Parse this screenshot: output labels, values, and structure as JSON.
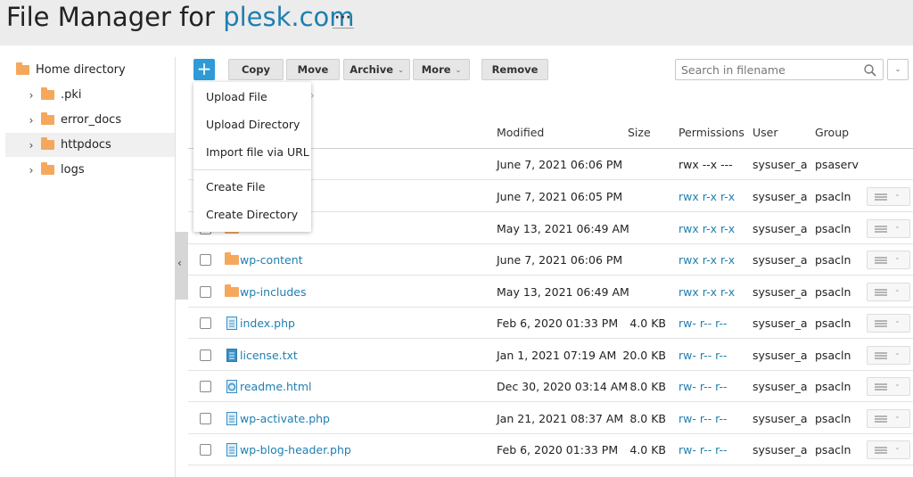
{
  "header": {
    "title_prefix": "File Manager for",
    "domain": "plesk.com",
    "menu_label": "···"
  },
  "sidebar": {
    "items": [
      {
        "label": "Home directory"
      },
      {
        "label": ".pki"
      },
      {
        "label": "error_docs"
      },
      {
        "label": "httpdocs"
      },
      {
        "label": "logs"
      }
    ],
    "collapse_icon": "chevron-left-icon"
  },
  "toolbar": {
    "add_label": "+",
    "copy": "Copy",
    "move": "Move",
    "archive": "Archive",
    "more": "More",
    "remove": "Remove"
  },
  "search": {
    "placeholder": "Search in filename"
  },
  "dropdown": {
    "items": [
      "Upload File",
      "Upload Directory",
      "Import file via URL",
      "Create File",
      "Create Directory"
    ]
  },
  "table": {
    "columns": {
      "modified": "Modified",
      "size": "Size",
      "permissions": "Permissions",
      "user": "User",
      "group": "Group"
    },
    "rows": [
      {
        "name": "",
        "modified": "June 7, 2021 06:06 PM",
        "size": "",
        "perm": "rwx --x ---",
        "user": "sysuser_a",
        "group": "psaserv"
      },
      {
        "name": "",
        "modified": "June 7, 2021 06:05 PM",
        "size": "",
        "perm": "rwx r-x r-x",
        "user": "sysuser_a",
        "group": "psacln"
      },
      {
        "name": "",
        "modified": "May 13, 2021 06:49 AM",
        "size": "",
        "perm": "rwx r-x r-x",
        "user": "sysuser_a",
        "group": "psacln"
      },
      {
        "name": "wp-content",
        "modified": "June 7, 2021 06:06 PM",
        "size": "",
        "perm": "rwx r-x r-x",
        "user": "sysuser_a",
        "group": "psacln"
      },
      {
        "name": "wp-includes",
        "modified": "May 13, 2021 06:49 AM",
        "size": "",
        "perm": "rwx r-x r-x",
        "user": "sysuser_a",
        "group": "psacln"
      },
      {
        "name": "index.php",
        "modified": "Feb 6, 2020 01:33 PM",
        "size": "4.0 KB",
        "perm": "rw- r-- r--",
        "user": "sysuser_a",
        "group": "psacln"
      },
      {
        "name": "license.txt",
        "modified": "Jan 1, 2021 07:19 AM",
        "size": "20.0 KB",
        "perm": "rw- r-- r--",
        "user": "sysuser_a",
        "group": "psacln"
      },
      {
        "name": "readme.html",
        "modified": "Dec 30, 2020 03:14 AM",
        "size": "8.0 KB",
        "perm": "rw- r-- r--",
        "user": "sysuser_a",
        "group": "psacln"
      },
      {
        "name": "wp-activate.php",
        "modified": "Jan 21, 2021 08:37 AM",
        "size": "8.0 KB",
        "perm": "rw- r-- r--",
        "user": "sysuser_a",
        "group": "psacln"
      },
      {
        "name": "wp-blog-header.php",
        "modified": "Feb 6, 2020 01:33 PM",
        "size": "4.0 KB",
        "perm": "rw- r-- r--",
        "user": "sysuser_a",
        "group": "psacln"
      }
    ]
  },
  "colors": {
    "accent": "#2f9bd6",
    "link": "#1e7fb0",
    "folder": "#f5a85c"
  }
}
